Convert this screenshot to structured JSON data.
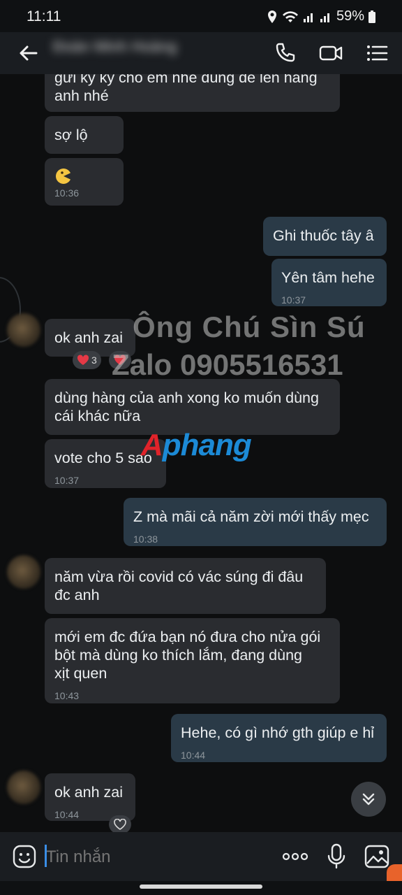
{
  "status_bar": {
    "time": "11:11",
    "battery": "59%"
  },
  "header": {
    "contact_name": "Đoàn Minh Hoàng"
  },
  "messages": [
    {
      "side": "in",
      "text": "gửi ký ký cho em nhé dùng để lên hàng\nanh nhé",
      "time": ""
    },
    {
      "side": "in",
      "text": "sợ lộ",
      "time": ""
    },
    {
      "side": "in",
      "text": "",
      "time": "10:36",
      "sticker": true
    },
    {
      "side": "out",
      "text": "Ghi thuốc tây â",
      "time": ""
    },
    {
      "side": "out",
      "text": "Yên tâm hehe",
      "time": "10:37"
    },
    {
      "side": "in",
      "text": "ok anh zai",
      "time": "",
      "reaction_count": "3"
    },
    {
      "side": "in",
      "text": "dùng hàng của anh xong ko muốn dùng\ncái khác nữa",
      "time": ""
    },
    {
      "side": "in",
      "text": "vote cho 5 sao",
      "time": "10:37"
    },
    {
      "side": "out",
      "text": "Z mà mãi cả năm zời mới thấy mẹc",
      "time": "10:38"
    },
    {
      "side": "in",
      "text": "năm vừa rồi covid có vác súng đi đâu\nđc anh",
      "time": ""
    },
    {
      "side": "in",
      "text": "mới em đc đứa bạn nó đưa cho nửa gói\nbột mà dùng ko thích lắm, đang dùng\nxịt quen",
      "time": "10:43"
    },
    {
      "side": "out",
      "text": "Hehe, có gì nhớ gth giúp e hỉ",
      "time": "10:44"
    },
    {
      "side": "in",
      "text": "ok anh zai",
      "time": "10:44"
    }
  ],
  "watermark": {
    "line1": "Ông Chú Sìn Sú",
    "line2": "Zalo 0905516531",
    "logo_a": "A",
    "logo_b": "phang"
  },
  "input": {
    "placeholder": "Tin nhắn"
  },
  "colors": {
    "incoming_bubble": "#2a2c30",
    "outgoing_bubble": "#2a3a47",
    "background": "#0d0e0f"
  },
  "icons": [
    "back-arrow-icon",
    "phone-icon",
    "video-call-icon",
    "menu-list-icon",
    "emoji-icon",
    "more-dots-icon",
    "microphone-icon",
    "image-icon",
    "chevron-double-down-icon",
    "heart-icon"
  ]
}
